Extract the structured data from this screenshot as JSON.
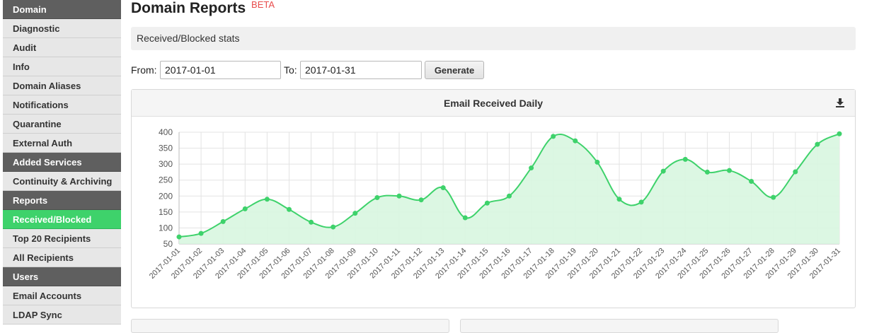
{
  "sidebar": {
    "items": [
      {
        "label": "Domain",
        "type": "header"
      },
      {
        "label": "Diagnostic",
        "type": "item"
      },
      {
        "label": "Audit",
        "type": "item"
      },
      {
        "label": "Info",
        "type": "item"
      },
      {
        "label": "Domain Aliases",
        "type": "item"
      },
      {
        "label": "Notifications",
        "type": "item"
      },
      {
        "label": "Quarantine",
        "type": "item"
      },
      {
        "label": "External Auth",
        "type": "item"
      },
      {
        "label": "Added Services",
        "type": "header"
      },
      {
        "label": "Continuity & Archiving",
        "type": "item"
      },
      {
        "label": "Reports",
        "type": "header"
      },
      {
        "label": "Received/Blocked",
        "type": "active"
      },
      {
        "label": "Top 20 Recipients",
        "type": "item"
      },
      {
        "label": "All Recipients",
        "type": "item"
      },
      {
        "label": "Users",
        "type": "header"
      },
      {
        "label": "Email Accounts",
        "type": "item"
      },
      {
        "label": "LDAP Sync",
        "type": "item"
      }
    ]
  },
  "page": {
    "title": "Domain Reports",
    "badge": "BETA",
    "stats_label": "Received/Blocked stats"
  },
  "form": {
    "from_label": "From:",
    "from_value": "2017-01-01",
    "to_label": "To:",
    "to_value": "2017-01-31",
    "generate_label": "Generate"
  },
  "panel": {
    "title": "Email Received Daily",
    "download_icon": "download-icon"
  },
  "colors": {
    "accent": "#3ed26b",
    "sidebar_header": "#5f5f5f",
    "beta": "#e84c4c",
    "series_fill": "#d8f6e0"
  },
  "chart_data": {
    "type": "area",
    "title": "Email Received Daily",
    "xlabel": "",
    "ylabel": "",
    "ylim": [
      50,
      400
    ],
    "yticks": [
      50,
      100,
      150,
      200,
      250,
      300,
      350,
      400
    ],
    "grid": true,
    "legend": "none",
    "x": [
      "2017-01-01",
      "2017-01-02",
      "2017-01-03",
      "2017-01-04",
      "2017-01-05",
      "2017-01-06",
      "2017-01-07",
      "2017-01-08",
      "2017-01-09",
      "2017-01-10",
      "2017-01-11",
      "2017-01-12",
      "2017-01-13",
      "2017-01-14",
      "2017-01-15",
      "2017-01-16",
      "2017-01-17",
      "2017-01-18",
      "2017-01-19",
      "2017-01-20",
      "2017-01-21",
      "2017-01-22",
      "2017-01-23",
      "2017-01-24",
      "2017-01-25",
      "2017-01-26",
      "2017-01-27",
      "2017-01-28",
      "2017-01-29",
      "2017-01-30",
      "2017-01-31"
    ],
    "series": [
      {
        "values": [
          72,
          83,
          120,
          160,
          190,
          158,
          118,
          103,
          146,
          195,
          200,
          188,
          226,
          132,
          178,
          200,
          288,
          387,
          373,
          306,
          190,
          181,
          278,
          315,
          275,
          280,
          246,
          196,
          276,
          362,
          395
        ]
      }
    ]
  }
}
